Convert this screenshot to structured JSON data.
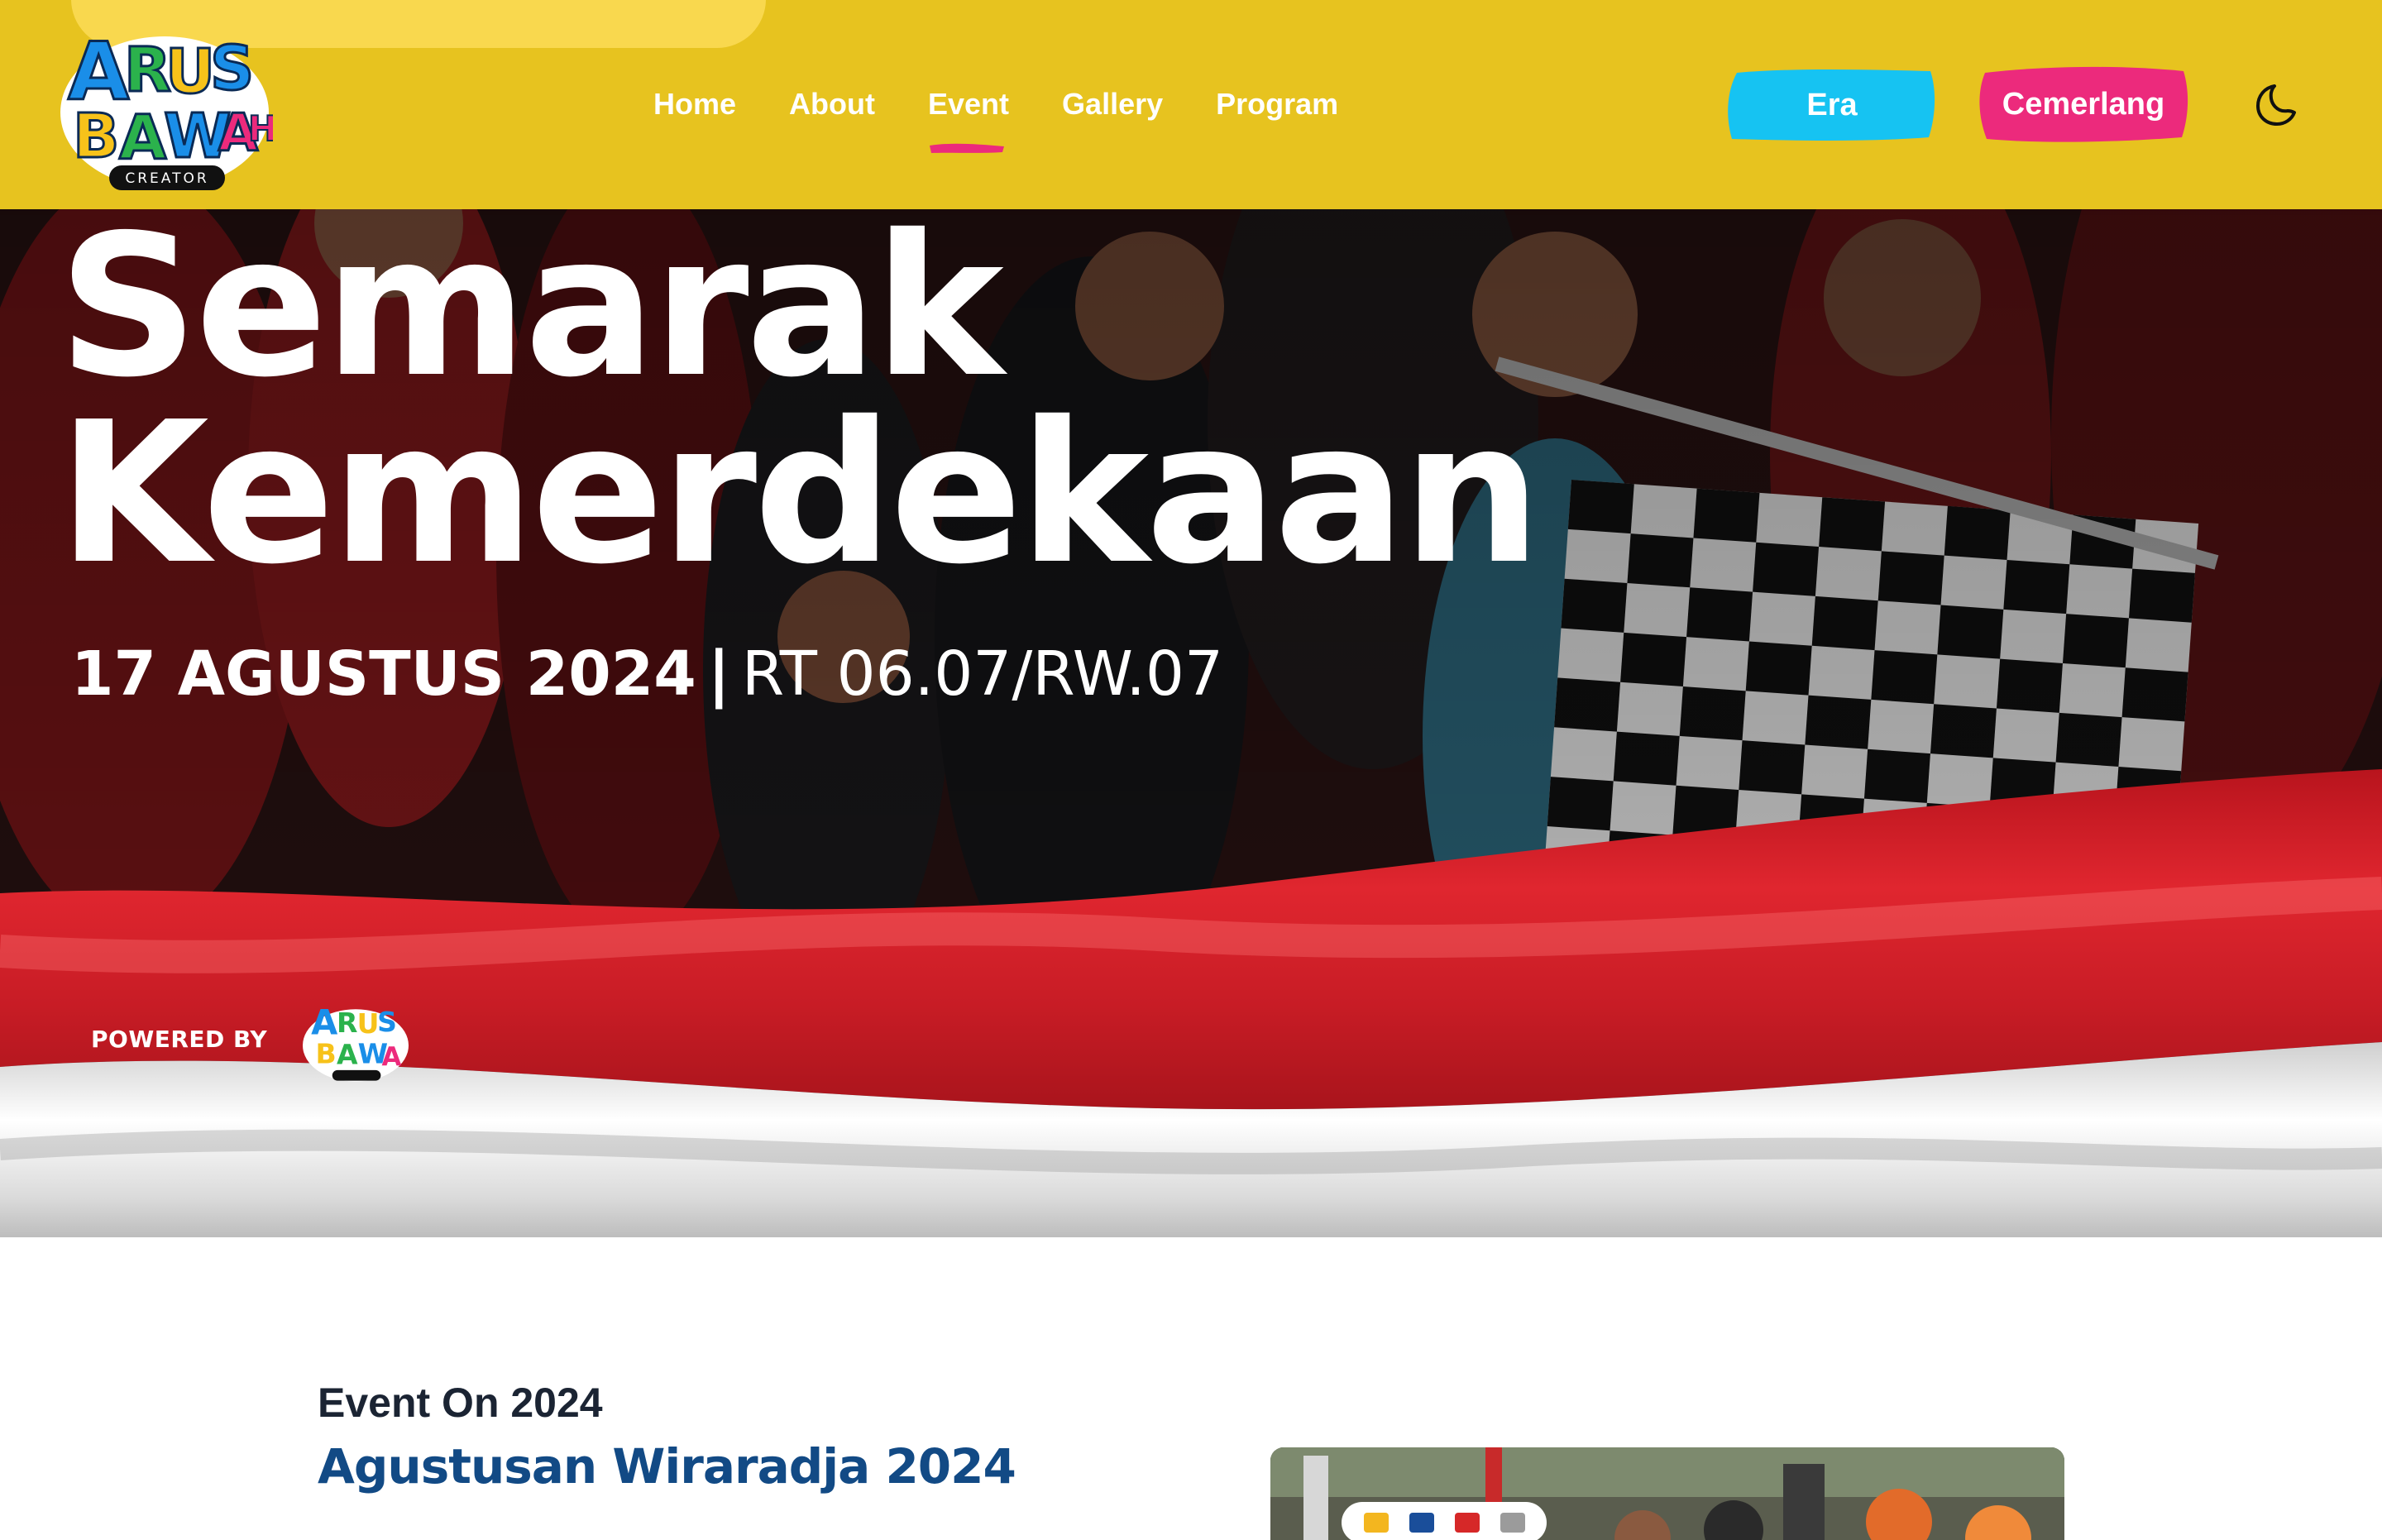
{
  "colors": {
    "header_bg": "#EDC920",
    "accent_cyan": "#16C3F2",
    "accent_pink": "#EC2A7C",
    "flag_red": "#D8202A",
    "flag_white": "#F2F2F2",
    "event_title": "#124A85"
  },
  "header": {
    "logo": {
      "alt_text": "Arus Bawah Creator",
      "icon": "arus-bawah-logo"
    },
    "nav": [
      {
        "label": "Home",
        "active": false
      },
      {
        "label": "About",
        "active": false
      },
      {
        "label": "Event",
        "active": true
      },
      {
        "label": "Gallery",
        "active": false
      },
      {
        "label": "Program",
        "active": false
      }
    ],
    "buttons": {
      "era": "Era",
      "cemerlang": "Cemerlang"
    },
    "theme_toggle_icon": "moon-icon"
  },
  "hero": {
    "title_line1": "Semarak",
    "title_line2": "Kemerdekaan",
    "date": "17 AGUSTUS 2024",
    "separator": "|",
    "location": "RT 06.07/RW.07",
    "powered_by": "POWERED BY"
  },
  "event": {
    "pre_title": "Event On 2024",
    "title": "Agustusan Wiraradja 2024"
  }
}
